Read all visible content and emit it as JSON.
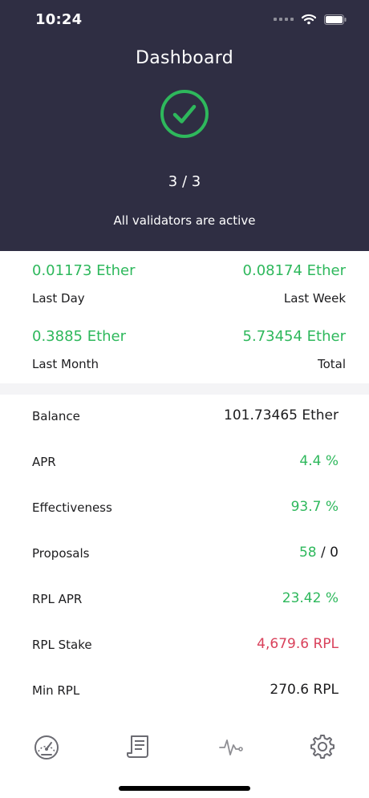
{
  "status_bar": {
    "time": "10:24"
  },
  "header": {
    "title": "Dashboard",
    "validator_count": "3 / 3",
    "status_text": "All validators are active"
  },
  "earnings": {
    "last_day": {
      "value": "0.01173 Ether",
      "label": "Last Day"
    },
    "last_week": {
      "value": "0.08174 Ether",
      "label": "Last Week"
    },
    "last_month": {
      "value": "0.3885 Ether",
      "label": "Last Month"
    },
    "total": {
      "value": "5.73454 Ether",
      "label": "Total"
    }
  },
  "stats": {
    "balance": {
      "label": "Balance",
      "value": "101.73465 Ether"
    },
    "apr": {
      "label": "APR",
      "value": "4.4 %"
    },
    "effectiveness": {
      "label": "Effectiveness",
      "value": "93.7 %"
    },
    "proposals": {
      "label": "Proposals",
      "value_success": "58",
      "separator": " / ",
      "value_missed": "0"
    },
    "rpl_apr": {
      "label": "RPL APR",
      "value": "23.42 %"
    },
    "rpl_stake": {
      "label": "RPL Stake",
      "value": "4,679.6 RPL"
    },
    "min_rpl": {
      "label": "Min RPL",
      "value": "270.6 RPL"
    }
  },
  "tabbar": {
    "items": [
      {
        "icon": "speedometer-icon"
      },
      {
        "icon": "receipt-icon"
      },
      {
        "icon": "pulse-icon"
      },
      {
        "icon": "gear-icon"
      }
    ]
  },
  "colors": {
    "header_bg": "#2f2e43",
    "positive": "#2eb85c",
    "negative": "#d9415b"
  }
}
